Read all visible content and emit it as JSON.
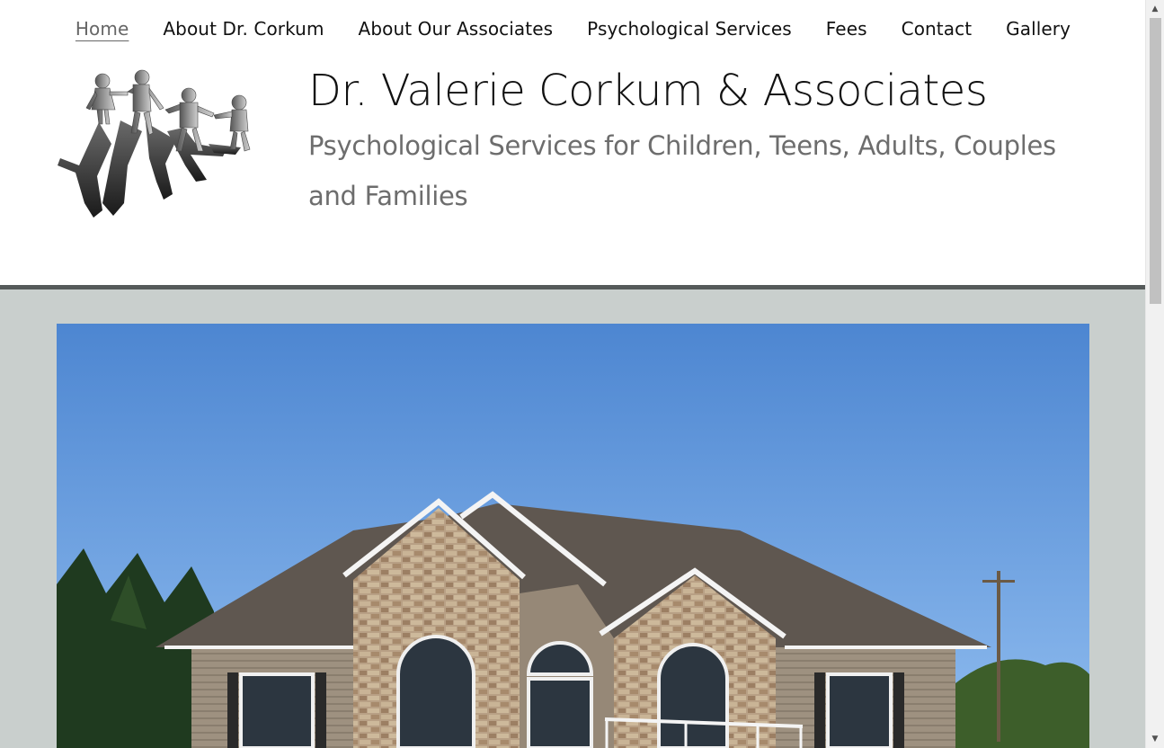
{
  "nav": {
    "items": [
      {
        "label": "Home",
        "active": true
      },
      {
        "label": "About Dr. Corkum"
      },
      {
        "label": "About Our Associates"
      },
      {
        "label": "Psychological Services"
      },
      {
        "label": "Fees"
      },
      {
        "label": "Contact"
      },
      {
        "label": "Gallery"
      }
    ]
  },
  "header": {
    "title": "Dr. Valerie Corkum & Associates",
    "tagline": "Psychological Services for Children, Teens, Adults, Couples and Families"
  },
  "colors": {
    "main_background": "#c9cfcd",
    "header_rule": "#555a5a",
    "sky": "#5a8ed6"
  },
  "icons": {
    "scroll_up": "scroll-up-arrow-icon",
    "scroll_down": "scroll-down-arrow-icon"
  }
}
